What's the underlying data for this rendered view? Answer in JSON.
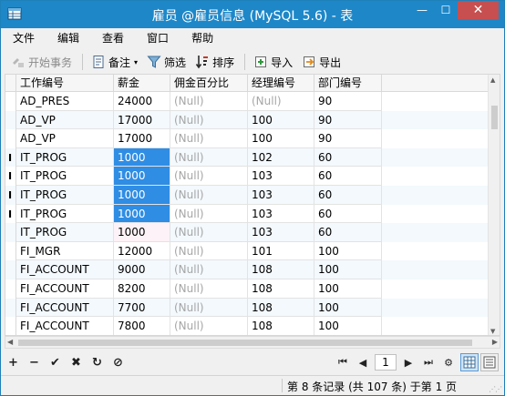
{
  "window": {
    "title": "雇员 @雇员信息 (MySQL 5.6) - 表",
    "minimize_glyph": "—",
    "maximize_glyph": "☐",
    "close_glyph": "✕"
  },
  "menu": [
    {
      "label": "文件"
    },
    {
      "label": "编辑"
    },
    {
      "label": "查看"
    },
    {
      "label": "窗口"
    },
    {
      "label": "帮助"
    }
  ],
  "toolbar": {
    "begin_transaction": "开始事务",
    "memo": "备注",
    "memo_arrow": "▾",
    "filter": "筛选",
    "sort": "排序",
    "import": "导入",
    "export": "导出"
  },
  "grid": {
    "columns": [
      "工作编号",
      "薪金",
      "佣金百分比",
      "经理编号",
      "部门编号"
    ],
    "rows": [
      {
        "cells": [
          "AD_PRES",
          "24000",
          "(Null)",
          "(Null)",
          "90"
        ],
        "marker": ""
      },
      {
        "cells": [
          "AD_VP",
          "17000",
          "(Null)",
          "100",
          "90"
        ],
        "marker": ""
      },
      {
        "cells": [
          "AD_VP",
          "17000",
          "(Null)",
          "100",
          "90"
        ],
        "marker": ""
      },
      {
        "cells": [
          "IT_PROG",
          "1000",
          "(Null)",
          "102",
          "60"
        ],
        "marker": "I",
        "selected": true
      },
      {
        "cells": [
          "IT_PROG",
          "1000",
          "(Null)",
          "103",
          "60"
        ],
        "marker": "I",
        "selected": true
      },
      {
        "cells": [
          "IT_PROG",
          "1000",
          "(Null)",
          "103",
          "60"
        ],
        "marker": "I",
        "selected": true
      },
      {
        "cells": [
          "IT_PROG",
          "1000",
          "(Null)",
          "103",
          "60"
        ],
        "marker": "I",
        "selected": true
      },
      {
        "cells": [
          "IT_PROG",
          "1000",
          "(Null)",
          "103",
          "60"
        ],
        "marker": "",
        "soft": true
      },
      {
        "cells": [
          "FI_MGR",
          "12000",
          "(Null)",
          "101",
          "100"
        ],
        "marker": ""
      },
      {
        "cells": [
          "FI_ACCOUNT",
          "9000",
          "(Null)",
          "108",
          "100"
        ],
        "marker": ""
      },
      {
        "cells": [
          "FI_ACCOUNT",
          "8200",
          "(Null)",
          "108",
          "100"
        ],
        "marker": ""
      },
      {
        "cells": [
          "FI_ACCOUNT",
          "7700",
          "(Null)",
          "108",
          "100"
        ],
        "marker": ""
      },
      {
        "cells": [
          "FI_ACCOUNT",
          "7800",
          "(Null)",
          "108",
          "100"
        ],
        "marker": ""
      }
    ]
  },
  "bottom": {
    "add": "+",
    "delete": "−",
    "apply": "✔",
    "cancel": "✖",
    "refresh": "↻",
    "stop": "⊘",
    "first": "⏮",
    "prev": "◀",
    "page": "1",
    "next": "▶",
    "last": "⏭",
    "settings": "⚙"
  },
  "status": {
    "text": "第 8 条记录 (共 107 条) 于第 1 页"
  },
  "colors": {
    "titlebar": "#1e87c8",
    "selection": "#2f8de4",
    "null_text": "#a6a6a6"
  }
}
